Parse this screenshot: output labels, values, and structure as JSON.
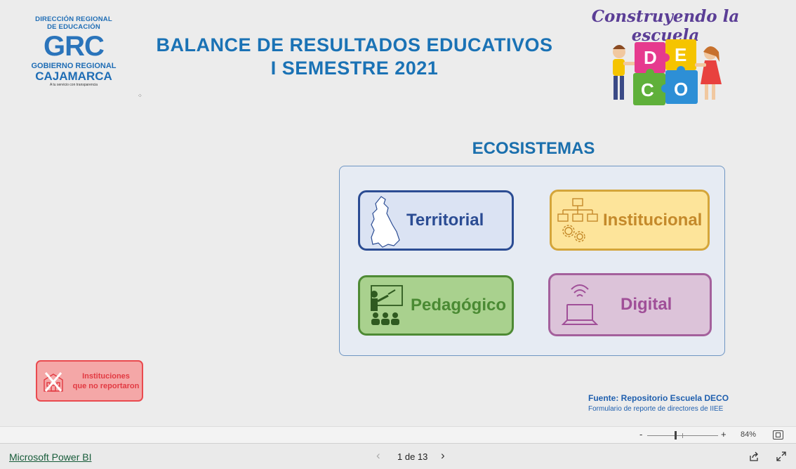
{
  "logo": {
    "line1": "DIRECCIÓN REGIONAL",
    "line2": "DE EDUCACIÓN",
    "mark": "GRC",
    "line3": "GOBIERNO REGIONAL",
    "line4": "CAJAMARCA",
    "tagline": "A tu servicio con transparencia"
  },
  "header": {
    "title_line1": "BALANCE DE RESULTADOS EDUCATIVOS",
    "title_line2": "I SEMESTRE 2021"
  },
  "deco": {
    "tagline": "Construyendo la escuela",
    "letters": [
      "D",
      "E",
      "C",
      "O"
    ]
  },
  "ecosystems": {
    "title": "ECOSISTEMAS",
    "cards": [
      {
        "label": "Territorial",
        "icon": "map-icon"
      },
      {
        "label": "Institucional",
        "icon": "org-chart-gears-icon"
      },
      {
        "label": "Pedagógico",
        "icon": "teacher-board-icon"
      },
      {
        "label": "Digital",
        "icon": "laptop-wifi-icon"
      }
    ]
  },
  "no_report_button": {
    "line1": "Instituciones",
    "line2": "que no reportaron"
  },
  "source": {
    "label": "Fuente: Repositorio Escuela DECO",
    "detail": "Formulario de reporte de directores de IIEE"
  },
  "zoom": {
    "minus": "-",
    "plus": "+",
    "value": "84%"
  },
  "footer": {
    "brand": "Microsoft Power BI",
    "page_indicator": "1 de 13"
  },
  "colors": {
    "title_blue": "#1a72b5",
    "territorial": "#2b4c93",
    "institucional": "#d4a53a",
    "pedagogico": "#4e8a34",
    "digital": "#a4609c",
    "no_report": "#e94a4f"
  }
}
